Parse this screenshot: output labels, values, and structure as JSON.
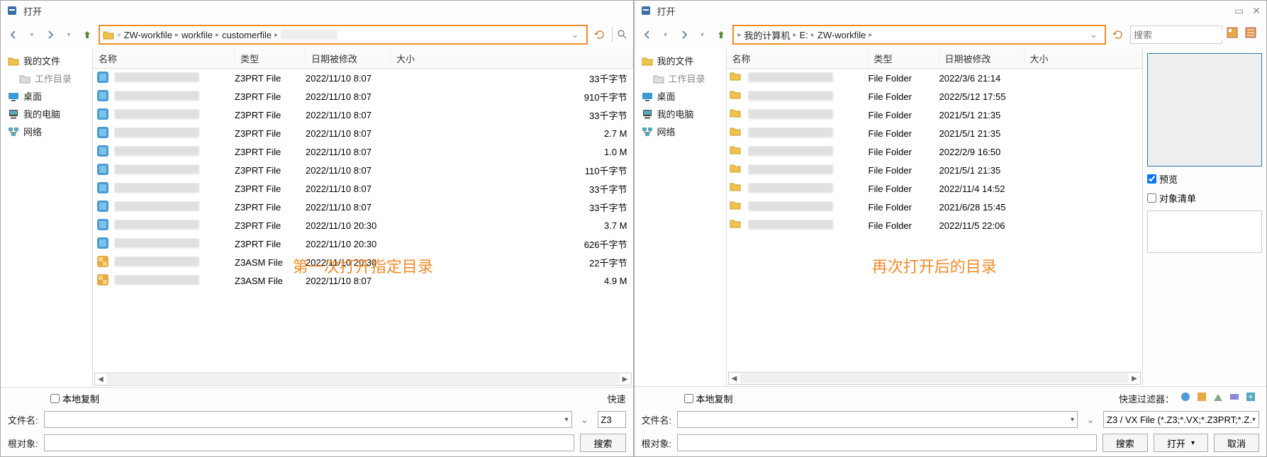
{
  "left": {
    "title": "打开",
    "breadcrumb": [
      "ZW-workfile",
      "workfile",
      "customerfile"
    ],
    "search_placeholder": "搜索",
    "sidebar": [
      {
        "label": "我的文件",
        "icon": "folder"
      },
      {
        "label": "工作目录",
        "icon": "folder-gray"
      },
      {
        "label": "桌面",
        "icon": "desktop"
      },
      {
        "label": "我的电脑",
        "icon": "computer"
      },
      {
        "label": "网络",
        "icon": "network"
      }
    ],
    "columns": {
      "name": "名称",
      "type": "类型",
      "date": "日期被修改",
      "size": "大小"
    },
    "files": [
      {
        "type": "Z3PRT File",
        "date": "2022/11/10 8:07",
        "size": "33千字节",
        "icon": "part"
      },
      {
        "type": "Z3PRT File",
        "date": "2022/11/10 8:07",
        "size": "910千字节",
        "icon": "part"
      },
      {
        "type": "Z3PRT File",
        "date": "2022/11/10 8:07",
        "size": "33千字节",
        "icon": "part"
      },
      {
        "type": "Z3PRT File",
        "date": "2022/11/10 8:07",
        "size": "2.7 M",
        "icon": "part"
      },
      {
        "type": "Z3PRT File",
        "date": "2022/11/10 8:07",
        "size": "1.0 M",
        "icon": "part"
      },
      {
        "type": "Z3PRT File",
        "date": "2022/11/10 8:07",
        "size": "110千字节",
        "icon": "part"
      },
      {
        "type": "Z3PRT File",
        "date": "2022/11/10 8:07",
        "size": "33千字节",
        "icon": "part"
      },
      {
        "type": "Z3PRT File",
        "date": "2022/11/10 8:07",
        "size": "33千字节",
        "icon": "part"
      },
      {
        "type": "Z3PRT File",
        "date": "2022/11/10 20:30",
        "size": "3.7 M",
        "icon": "part"
      },
      {
        "type": "Z3PRT File",
        "date": "2022/11/10 20:30",
        "size": "626千字节",
        "icon": "part"
      },
      {
        "type": "Z3ASM File",
        "date": "2022/11/10 20:30",
        "size": "22千字节",
        "icon": "asm"
      },
      {
        "type": "Z3ASM File",
        "date": "2022/11/10 8:07",
        "size": "4.9 M",
        "icon": "asm"
      }
    ],
    "caption": "第一次打开指定目录",
    "local_copy": "本地复制",
    "quick_label": "快速",
    "filename_label": "文件名:",
    "filetype_short": "Z3",
    "rootobj_label": "根对象:",
    "search_btn": "搜索"
  },
  "right": {
    "title": "打开",
    "breadcrumb": [
      "我的计算机",
      "E:",
      "ZW-workfile"
    ],
    "search_placeholder": "搜索",
    "sidebar": [
      {
        "label": "我的文件",
        "icon": "folder"
      },
      {
        "label": "工作目录",
        "icon": "folder-gray"
      },
      {
        "label": "桌面",
        "icon": "desktop"
      },
      {
        "label": "我的电脑",
        "icon": "computer"
      },
      {
        "label": "网络",
        "icon": "network"
      }
    ],
    "columns": {
      "name": "名称",
      "type": "类型",
      "date": "日期被修改",
      "size": "大小"
    },
    "files": [
      {
        "type": "File Folder",
        "date": "2022/3/6 21:14",
        "size": "",
        "icon": "folder"
      },
      {
        "type": "File Folder",
        "date": "2022/5/12 17:55",
        "size": "",
        "icon": "folder"
      },
      {
        "type": "File Folder",
        "date": "2021/5/1 21:35",
        "size": "",
        "icon": "folder"
      },
      {
        "type": "File Folder",
        "date": "2021/5/1 21:35",
        "size": "",
        "icon": "folder"
      },
      {
        "type": "File Folder",
        "date": "2022/2/9 16:50",
        "size": "",
        "icon": "folder"
      },
      {
        "type": "File Folder",
        "date": "2021/5/1 21:35",
        "size": "",
        "icon": "folder"
      },
      {
        "type": "File Folder",
        "date": "2022/11/4 14:52",
        "size": "",
        "icon": "folder"
      },
      {
        "type": "File Folder",
        "date": "2021/6/28 15:45",
        "size": "",
        "icon": "folder"
      },
      {
        "type": "File Folder",
        "date": "2022/11/5 22:06",
        "size": "",
        "icon": "folder"
      }
    ],
    "caption": "再次打开后的目录",
    "local_copy": "本地复制",
    "quick_filter_label": "快速过滤器：",
    "filename_label": "文件名:",
    "filetype_value": "Z3 / VX File (*.Z3;*.VX;*.Z3PRT;*.Z…",
    "rootobj_label": "根对象:",
    "search_btn": "搜索",
    "open_btn": "打开",
    "cancel_btn": "取消",
    "preview_label": "预览",
    "objectlist_label": "对象清单"
  }
}
